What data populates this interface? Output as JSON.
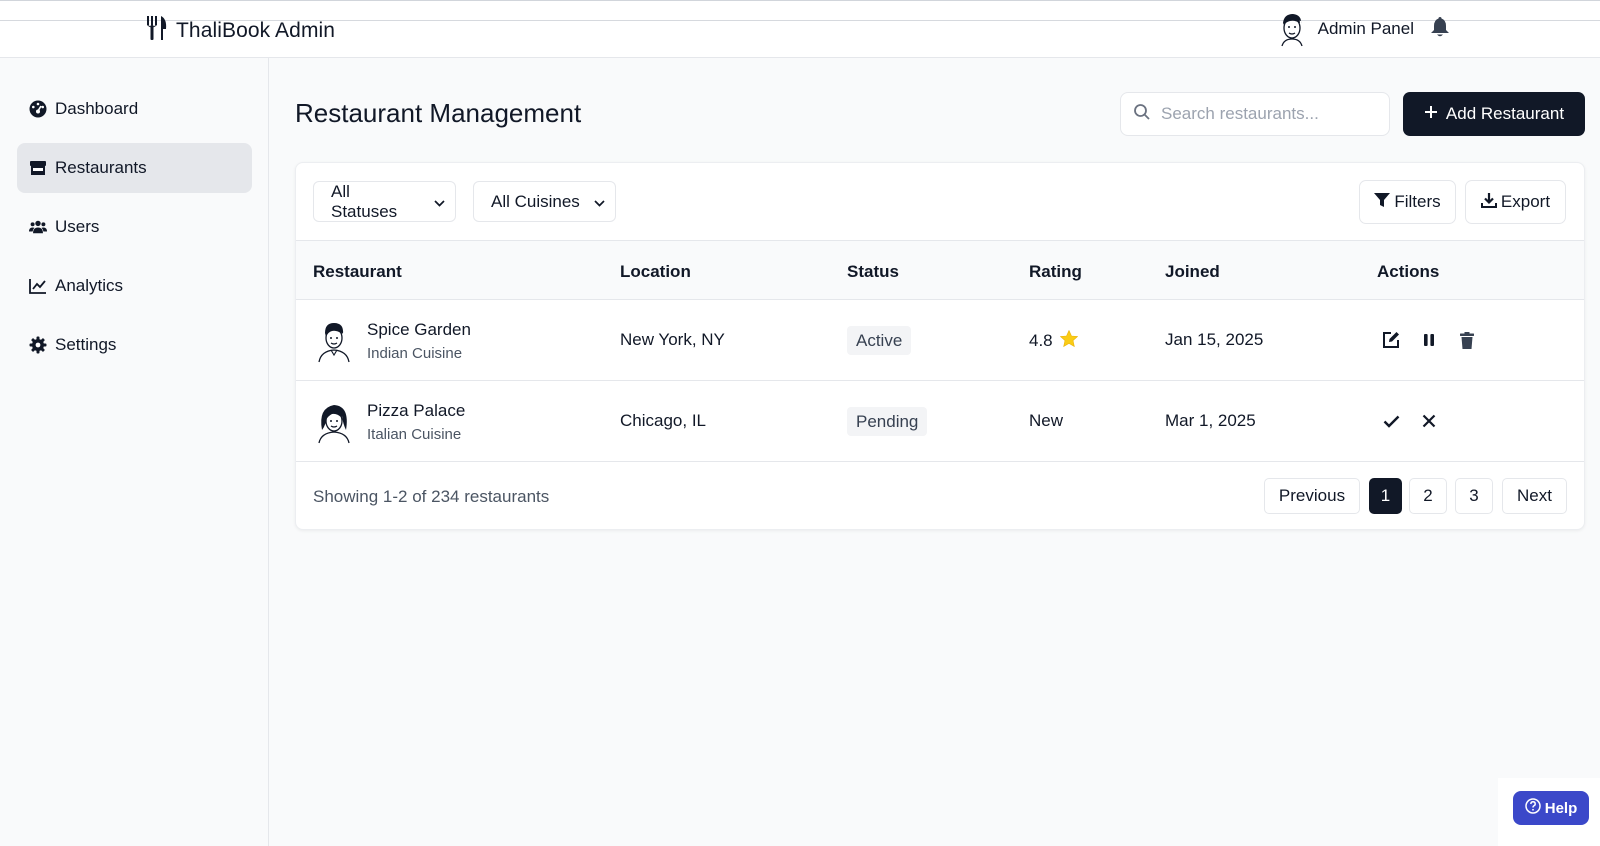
{
  "header": {
    "brand": "ThaliBook Admin",
    "admin_label": "Admin Panel",
    "brand_icon": "utensils-icon",
    "notification_icon": "bell-icon"
  },
  "sidebar": {
    "items": [
      {
        "label": "Dashboard",
        "icon": "dashboard-icon",
        "active": false
      },
      {
        "label": "Restaurants",
        "icon": "store-icon",
        "active": true
      },
      {
        "label": "Users",
        "icon": "users-icon",
        "active": false
      },
      {
        "label": "Analytics",
        "icon": "chart-line-icon",
        "active": false
      },
      {
        "label": "Settings",
        "icon": "gear-icon",
        "active": false
      }
    ]
  },
  "main": {
    "title": "Restaurant Management",
    "search_placeholder": "Search restaurants...",
    "add_button": "Add Restaurant"
  },
  "filters": {
    "status_select": "All Statuses",
    "cuisine_select": "All Cuisines",
    "filters_button": "Filters",
    "export_button": "Export"
  },
  "table": {
    "headers": [
      "Restaurant",
      "Location",
      "Status",
      "Rating",
      "Joined",
      "Actions"
    ],
    "rows": [
      {
        "name": "Spice Garden",
        "cuisine": "Indian Cuisine",
        "location": "New York, NY",
        "status": "Active",
        "rating": "4.8",
        "joined": "Jan 15, 2025"
      },
      {
        "name": "Pizza Palace",
        "cuisine": "Italian Cuisine",
        "location": "Chicago, IL",
        "status": "Pending",
        "rating": "New",
        "joined": "Mar 1, 2025"
      }
    ]
  },
  "pagination": {
    "showing": "Showing 1-2 of 234 restaurants",
    "previous": "Previous",
    "pages": [
      "1",
      "2",
      "3"
    ],
    "next": "Next",
    "current": "1"
  },
  "help": {
    "label": "Help"
  },
  "colors": {
    "primary": "#111827",
    "help": "#3b48c9",
    "star": "#facc15"
  }
}
